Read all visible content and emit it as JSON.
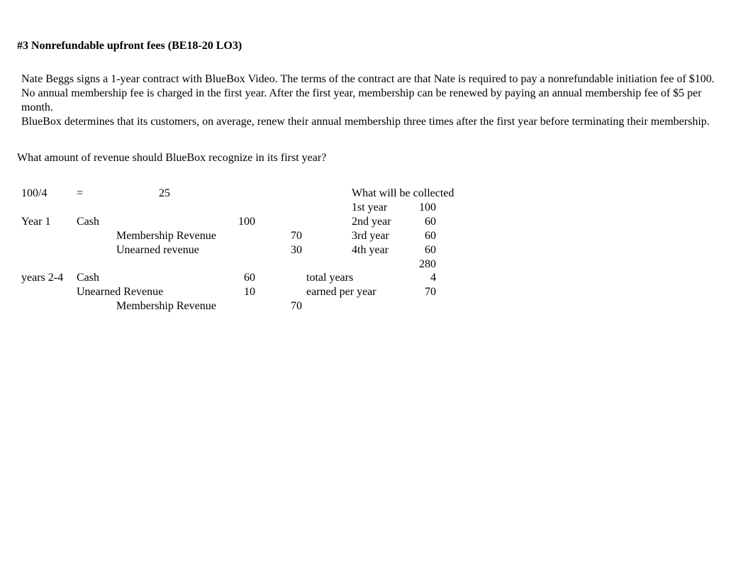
{
  "title": "#3 Nonrefundable upfront fees (BE18-20 LO3)",
  "para1": "Nate Beggs signs a 1-year contract with BlueBox Video. The terms of the contract are that Nate is required to pay a nonrefundable initiation fee of $100.",
  "para2": "No annual membership fee is charged in the first year. After the first year, membership can be renewed by paying an annual membership fee of $5 per month.",
  "para3": "BlueBox determines that its customers, on average, renew their annual membership three times after the first year before terminating their membership.",
  "question": "What amount of revenue should BlueBox recognize in its first year?",
  "calc": {
    "divExpr": "100/4",
    "eq": "=",
    "divResult": "25"
  },
  "entries": {
    "year1_label": "Year 1",
    "year1_cash": "Cash",
    "year1_cash_debit": "100",
    "year1_memrev": "Membership Revenue",
    "year1_memrev_credit": "70",
    "year1_unearned": "Unearned revenue",
    "year1_unearned_credit": "30",
    "year24_label": "years 2-4",
    "year24_cash": "Cash",
    "year24_cash_debit": "60",
    "year24_unearned": "Unearned Revenue",
    "year24_unearned_debit": "10",
    "year24_memrev": "Membership Revenue",
    "year24_memrev_credit": "70"
  },
  "collected": {
    "header": "What will be collected",
    "y1_label": "1st year",
    "y1_val": "100",
    "y2_label": "2nd year",
    "y2_val": "60",
    "y3_label": "3rd year",
    "y3_val": "60",
    "y4_label": "4th year",
    "y4_val": "60",
    "total": "280",
    "total_years_label": "total years",
    "total_years_val": "4",
    "earned_label": "earned per year",
    "earned_val": "70"
  }
}
